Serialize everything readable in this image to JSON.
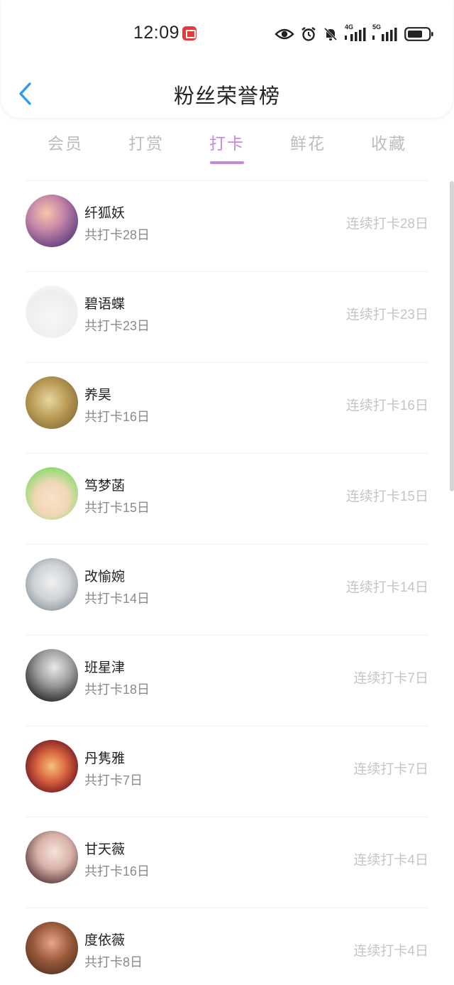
{
  "status_bar": {
    "time": "12:09",
    "network_4g": "4G",
    "network_5g": "5G"
  },
  "header": {
    "title": "粉丝荣誉榜"
  },
  "tabs": [
    {
      "label": "会员",
      "active": false
    },
    {
      "label": "打赏",
      "active": false
    },
    {
      "label": "打卡",
      "active": true
    },
    {
      "label": "鲜花",
      "active": false
    },
    {
      "label": "收藏",
      "active": false
    }
  ],
  "colors": {
    "accent": "#c48bd8",
    "muted_text": "#8a8a8a",
    "streak_text": "#c5c5c5"
  },
  "fans": [
    {
      "name": "纤狐妖",
      "total": "共打卡28日",
      "streak": "连续打卡28日"
    },
    {
      "name": "碧语蝶",
      "total": "共打卡23日",
      "streak": "连续打卡23日"
    },
    {
      "name": "养昊",
      "total": "共打卡16日",
      "streak": "连续打卡16日"
    },
    {
      "name": "笃梦菡",
      "total": "共打卡15日",
      "streak": "连续打卡15日"
    },
    {
      "name": "改愉婉",
      "total": "共打卡14日",
      "streak": "连续打卡14日"
    },
    {
      "name": "班星津",
      "total": "共打卡18日",
      "streak": "连续打卡7日"
    },
    {
      "name": "丹隽雅",
      "total": "共打卡7日",
      "streak": "连续打卡7日"
    },
    {
      "name": "甘天薇",
      "total": "共打卡16日",
      "streak": "连续打卡4日"
    },
    {
      "name": "度依薇",
      "total": "共打卡8日",
      "streak": "连续打卡4日"
    }
  ]
}
